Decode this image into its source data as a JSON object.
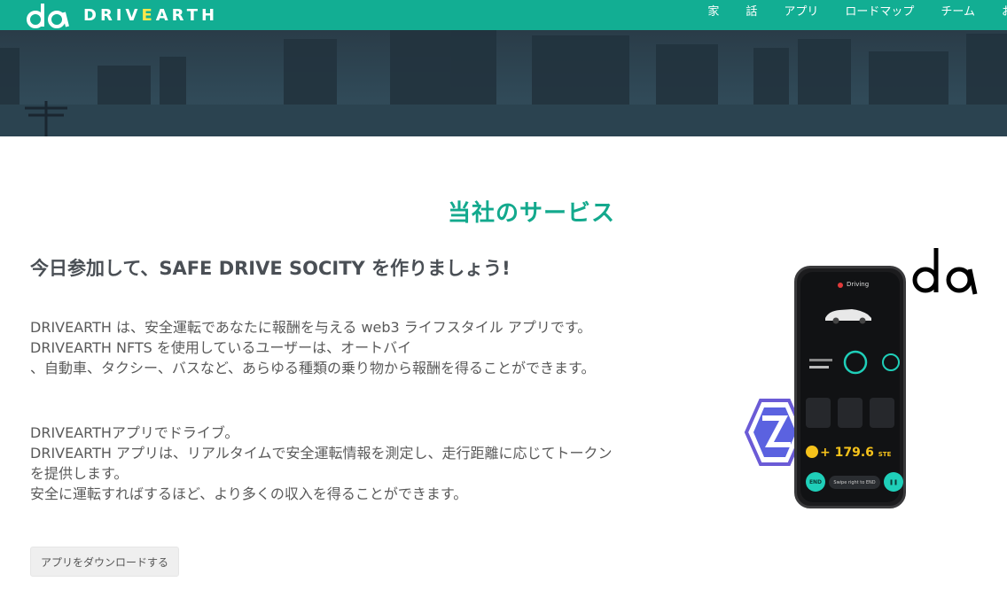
{
  "header": {
    "brand_prefix": "DRIV",
    "brand_accent": "E",
    "brand_suffix": "ARTH",
    "nav_items": [
      "家",
      "話",
      "アプリ",
      "ロードマップ",
      "チーム",
      "お"
    ]
  },
  "main": {
    "section_title": "当社のサービス",
    "headline": "今日参加して、SAFE DRIVE SOCITY を作りましょう!",
    "paragraph1": [
      "DRIVEARTH は、安全運転であなたに報酬を与える web3 ライフスタイル アプリです。",
      "DRIVEARTH NFTS を使用しているユーザーは、オートバイ",
      "、自動車、タクシー、バスなど、あらゆる種類の乗り物から報酬を得ることができます。"
    ],
    "paragraph2": [
      "DRIVEARTHアプリでドライブ。",
      "DRIVEARTH アプリは、リアルタイムで安全運転情報を測定し、走行距離に応じてトークン",
      "を提供します。",
      "安全に運転すればするほど、より多くの収入を得ることができます。"
    ],
    "download_button": "アプリをダウンロードする"
  },
  "phone": {
    "screen_title": "Driving",
    "amount": "+ 179.6",
    "amount_unit": "STE",
    "end_label": "END",
    "swipe_label": "Swipe right to END"
  },
  "colors": {
    "brand": "#12ae93",
    "accent": "#ffe74a",
    "title": "#13a98d"
  }
}
